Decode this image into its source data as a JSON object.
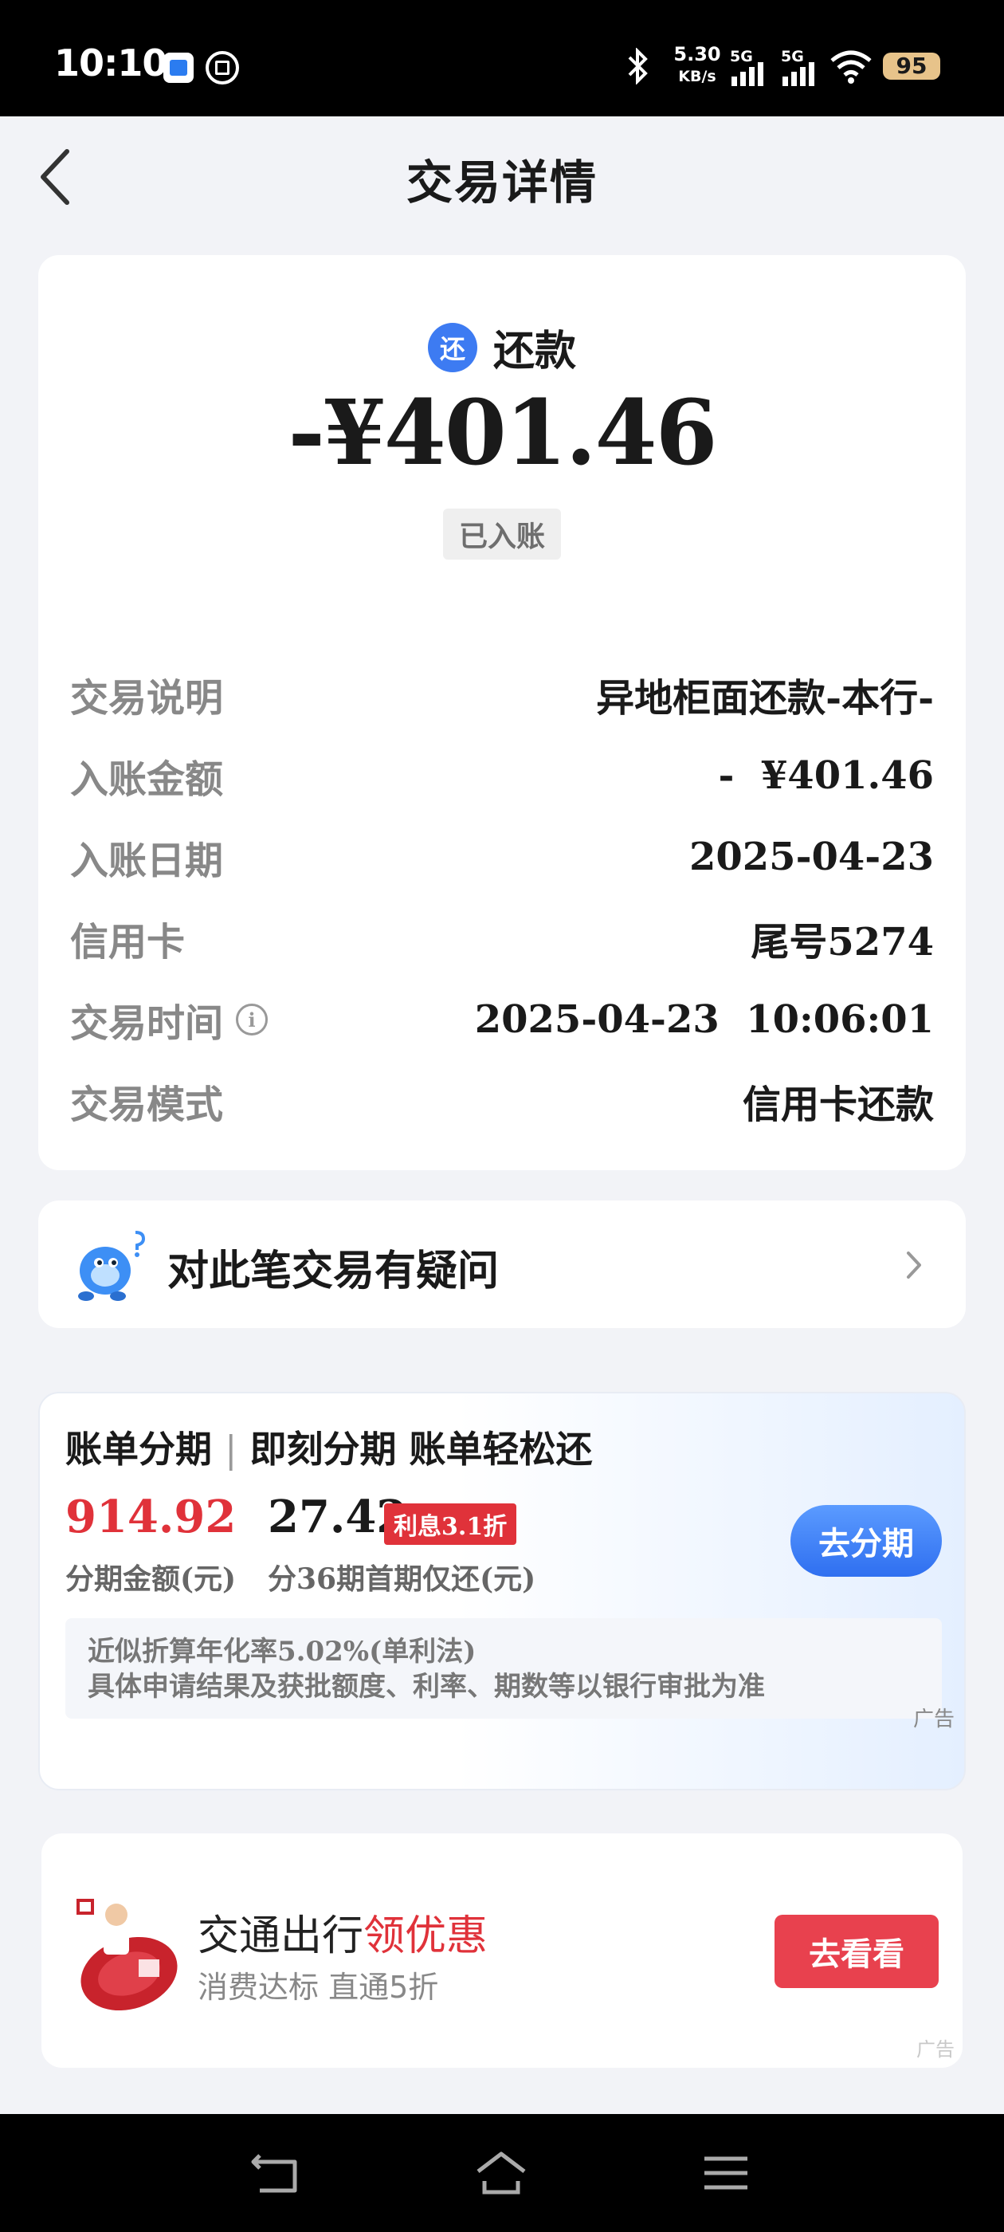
{
  "status_bar": {
    "time": "10:10",
    "net_speed_value": "5.30",
    "net_speed_unit": "KB/s",
    "sim1_label": "5G",
    "sim2_label": "5G",
    "battery": "95"
  },
  "header": {
    "title": "交易详情"
  },
  "transaction": {
    "type_icon_char": "还",
    "type_label": "还款",
    "amount": "-¥401.46",
    "status": "已入账",
    "details": [
      {
        "key": "交易说明",
        "value": "异地柜面还款-本行-"
      },
      {
        "key": "入账金额",
        "value": "-  ¥401.46"
      },
      {
        "key": "入账日期",
        "value": "2025-04-23"
      },
      {
        "key": "信用卡",
        "value": "尾号5274"
      },
      {
        "key": "交易时间",
        "value": "2025-04-23  10:06:01"
      },
      {
        "key": "交易模式",
        "value": "信用卡还款"
      }
    ]
  },
  "question": {
    "label": "对此笔交易有疑问"
  },
  "installment": {
    "title_a": "账单分期",
    "title_sep": "|",
    "title_b": "即刻分期  账单轻松还",
    "amount": "914.92",
    "amount_label": "分期金额(元)",
    "first_payment": "27.42",
    "tag": "利息3.1折",
    "first_label": "分36期首期仅还(元)",
    "button": "去分期",
    "note_line1": "近似折算年化率5.02%(单利法)",
    "note_line2": "具体申请结果及获批额度、利率、期数等以银行审批为准",
    "ad_label": "广告"
  },
  "promo": {
    "title_a": "交通出行",
    "title_b": "领优惠",
    "subtitle": "消费达标 直通5折",
    "button": "去看看",
    "ad_label": "广告"
  },
  "colors": {
    "accent_blue": "#3d7bf2",
    "accent_red": "#e0323a",
    "background": "#f2f3f7"
  }
}
